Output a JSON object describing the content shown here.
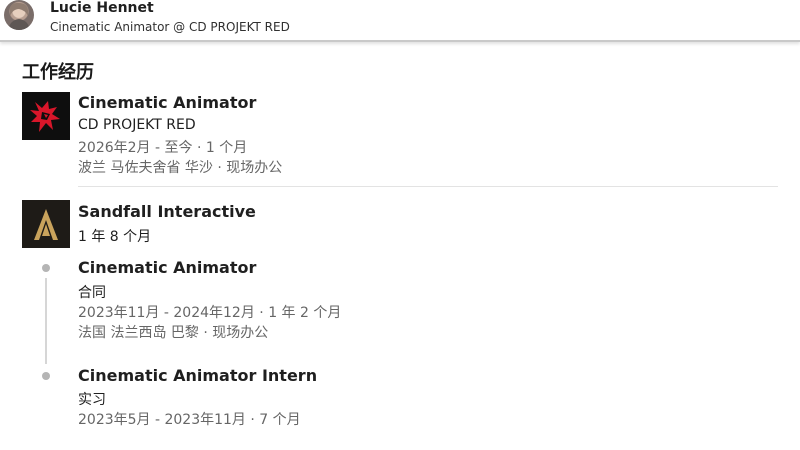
{
  "profile": {
    "name": "Lucie Hennet",
    "headline": "Cinematic Animator @ CD PROJEKT RED"
  },
  "section": {
    "title": "工作经历"
  },
  "experiences": [
    {
      "title": "Cinematic Animator",
      "company": "CD PROJEKT RED",
      "dates": "2026年2月 - 至今 · 1 个月",
      "location": "波兰 马佐夫舍省 华沙 · 现场办公",
      "logo_icon": "cd-projekt-red-logo",
      "logo_color": "#d8162a"
    },
    {
      "company": "Sandfall Interactive",
      "duration": "1 年 8 个月",
      "logo_icon": "sandfall-logo",
      "logo_color": "#c9a35c",
      "roles": [
        {
          "title": "Cinematic Animator",
          "type": "合同",
          "dates": "2023年11月 - 2024年12月 · 1 年 2 个月",
          "location": "法国 法兰西岛 巴黎 · 现场办公"
        },
        {
          "title": "Cinematic Animator Intern",
          "type": "实习",
          "dates": "2023年5月 - 2023年11月 · 7 个月"
        }
      ]
    }
  ]
}
